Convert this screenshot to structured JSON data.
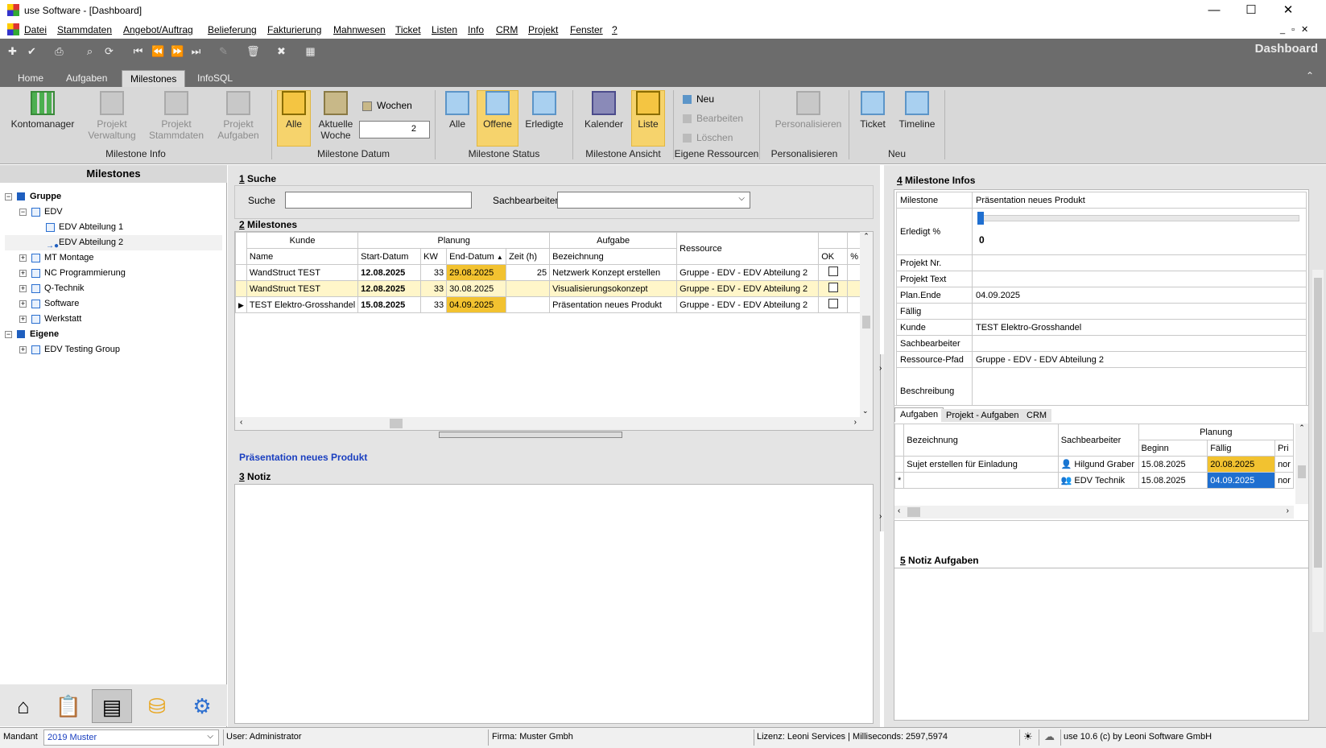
{
  "window": {
    "title": "use Software - [Dashboard]",
    "min": "—",
    "max": "☐",
    "close": "✕"
  },
  "menu": [
    "Datei",
    "Stammdaten",
    "Angebot/Auftrag",
    "Belieferung",
    "Fakturierung",
    "Mahnwesen",
    "Ticket",
    "Listen",
    "Info",
    "CRM",
    "Projekt",
    "Fenster",
    "?"
  ],
  "dashboard_title": "Dashboard",
  "ribbon_tabs": [
    "Home",
    "Aufgaben",
    "Milestones",
    "InfoSQL"
  ],
  "ribbon": {
    "kontomanager": "Kontomanager",
    "projekt_verwaltung": [
      "Projekt",
      "Verwaltung"
    ],
    "projekt_stammdaten": [
      "Projekt",
      "Stammdaten"
    ],
    "projekt_aufgaben": [
      "Projekt",
      "Aufgaben"
    ],
    "grp_info": "Milestone Info",
    "datum_alle": "Alle",
    "aktuelle_woche": [
      "Aktuelle",
      "Woche"
    ],
    "wochen": "Wochen",
    "wochen_value": "2",
    "grp_datum": "Milestone Datum",
    "status_alle": "Alle",
    "status_offene": "Offene",
    "status_erledigte": "Erledigte",
    "grp_status": "Milestone Status",
    "kalender": "Kalender",
    "liste": "Liste",
    "grp_ansicht": "Milestone Ansicht",
    "neu": "Neu",
    "bearbeiten": "Bearbeiten",
    "loeschen": "Löschen",
    "grp_eigene": "Eigene Ressourcen",
    "personalisieren": "Personalisieren",
    "grp_personalisieren": "Personalisieren",
    "ticket": "Ticket",
    "timeline": "Timeline",
    "grp_neu": "Neu"
  },
  "left": {
    "header": "Milestones",
    "tree": [
      {
        "label": "Gruppe",
        "level": 0,
        "bold": true,
        "exp": "−",
        "icon": "sq"
      },
      {
        "label": "EDV",
        "level": 1,
        "exp": "−",
        "icon": "gi"
      },
      {
        "label": "EDV Abteilung 1",
        "level": 2,
        "icon": "gi"
      },
      {
        "label": "EDV Abteilung 2",
        "level": 2,
        "icon": "dot",
        "selected": true
      },
      {
        "label": "MT Montage",
        "level": 1,
        "exp": "+",
        "icon": "gi"
      },
      {
        "label": "NC Programmierung",
        "level": 1,
        "exp": "+",
        "icon": "gi"
      },
      {
        "label": "Q-Technik",
        "level": 1,
        "exp": "+",
        "icon": "gi"
      },
      {
        "label": "Software",
        "level": 1,
        "exp": "+",
        "icon": "gi"
      },
      {
        "label": "Werkstatt",
        "level": 1,
        "exp": "+",
        "icon": "gi"
      },
      {
        "label": "Eigene",
        "level": 0,
        "bold": true,
        "exp": "−",
        "icon": "sq"
      },
      {
        "label": "EDV Testing Group",
        "level": 1,
        "exp": "+",
        "icon": "gi"
      }
    ]
  },
  "search": {
    "num": "1",
    "title": "Suche",
    "suche_label": "Suche",
    "suche_value": "",
    "sb_label": "Sachbearbeiter",
    "sb_value": ""
  },
  "milestones": {
    "num": "2",
    "title": "Milestones",
    "grp_kunde": "Kunde",
    "grp_planung": "Planung",
    "grp_aufgabe": "Aufgabe",
    "grp_ressource": "Ressource",
    "cols": [
      "Name",
      "Start-Datum",
      "KW",
      "End-Datum",
      "Zeit (h)",
      "Bezeichnung",
      "OK",
      "%"
    ],
    "rows": [
      {
        "name": "WandStruct TEST",
        "start": "12.08.2025",
        "kw": "33",
        "end": "29.08.2025",
        "zeit": "25",
        "bez": "Netzwerk Konzept erstellen",
        "res": "Gruppe - EDV - EDV Abteilung 2"
      },
      {
        "name": "WandStruct TEST",
        "start": "12.08.2025",
        "kw": "33",
        "end": "30.08.2025",
        "zeit": "",
        "bez": "Visualisierungsokonzept",
        "res": "Gruppe - EDV - EDV Abteilung 2"
      },
      {
        "name": "TEST Elektro-Grosshandel",
        "start": "15.08.2025",
        "kw": "33",
        "end": "04.09.2025",
        "zeit": "",
        "bez": "Präsentation neues Produkt",
        "res": "Gruppe - EDV - EDV Abteilung 2"
      }
    ],
    "selected_title": "Präsentation neues Produkt"
  },
  "notiz": {
    "num": "3",
    "title": "Notiz"
  },
  "infos": {
    "num": "4",
    "title": "Milestone Infos",
    "milestone_label": "Milestone",
    "milestone_value": "Präsentation neues Produkt",
    "erledigt_label": "Erledigt %",
    "erledigt_value": "0",
    "projekt_nr_label": "Projekt Nr.",
    "projekt_nr_value": "",
    "projekt_text_label": "Projekt Text",
    "projekt_text_value": "",
    "plan_ende_label": "Plan.Ende",
    "plan_ende_value": "04.09.2025",
    "faellig_label": "Fällig",
    "faellig_value": "",
    "kunde_label": "Kunde",
    "kunde_value": "TEST Elektro-Grosshandel",
    "sb_label": "Sachbearbeiter",
    "sb_value": "",
    "pfad_label": "Ressource-Pfad",
    "pfad_value": "Gruppe - EDV - EDV Abteilung 2",
    "beschreibung_label": "Beschreibung",
    "beschreibung_value": ""
  },
  "aufgaben": {
    "tabs": [
      "Aufgaben",
      "Projekt - Aufgaben",
      "CRM"
    ],
    "planung": "Planung",
    "cols": [
      "Bezeichnung",
      "Sachbearbeiter",
      "Beginn",
      "Fällig",
      "Pri"
    ],
    "rows": [
      {
        "bez": "Sujet erstellen für Einladung",
        "sb": "Hilgund Graber",
        "beginn": "15.08.2025",
        "faellig": "20.08.2025",
        "pri": "nor"
      },
      {
        "bez": "",
        "sb": "EDV Technik",
        "beginn": "15.08.2025",
        "faellig": "04.09.2025",
        "pri": "nor"
      }
    ],
    "new_marker": "*"
  },
  "notiz_aufgaben": {
    "num": "5",
    "title": "Notiz Aufgaben"
  },
  "status": {
    "mandant_label": "Mandant",
    "mandant_value": "2019 Muster",
    "user": "User: Administrator",
    "firma": "Firma: Muster Gmbh",
    "lizenz": "Lizenz: Leoni Services | Milliseconds: 2597,5974",
    "version": "use 10.6 (c) by Leoni Software GmbH"
  }
}
